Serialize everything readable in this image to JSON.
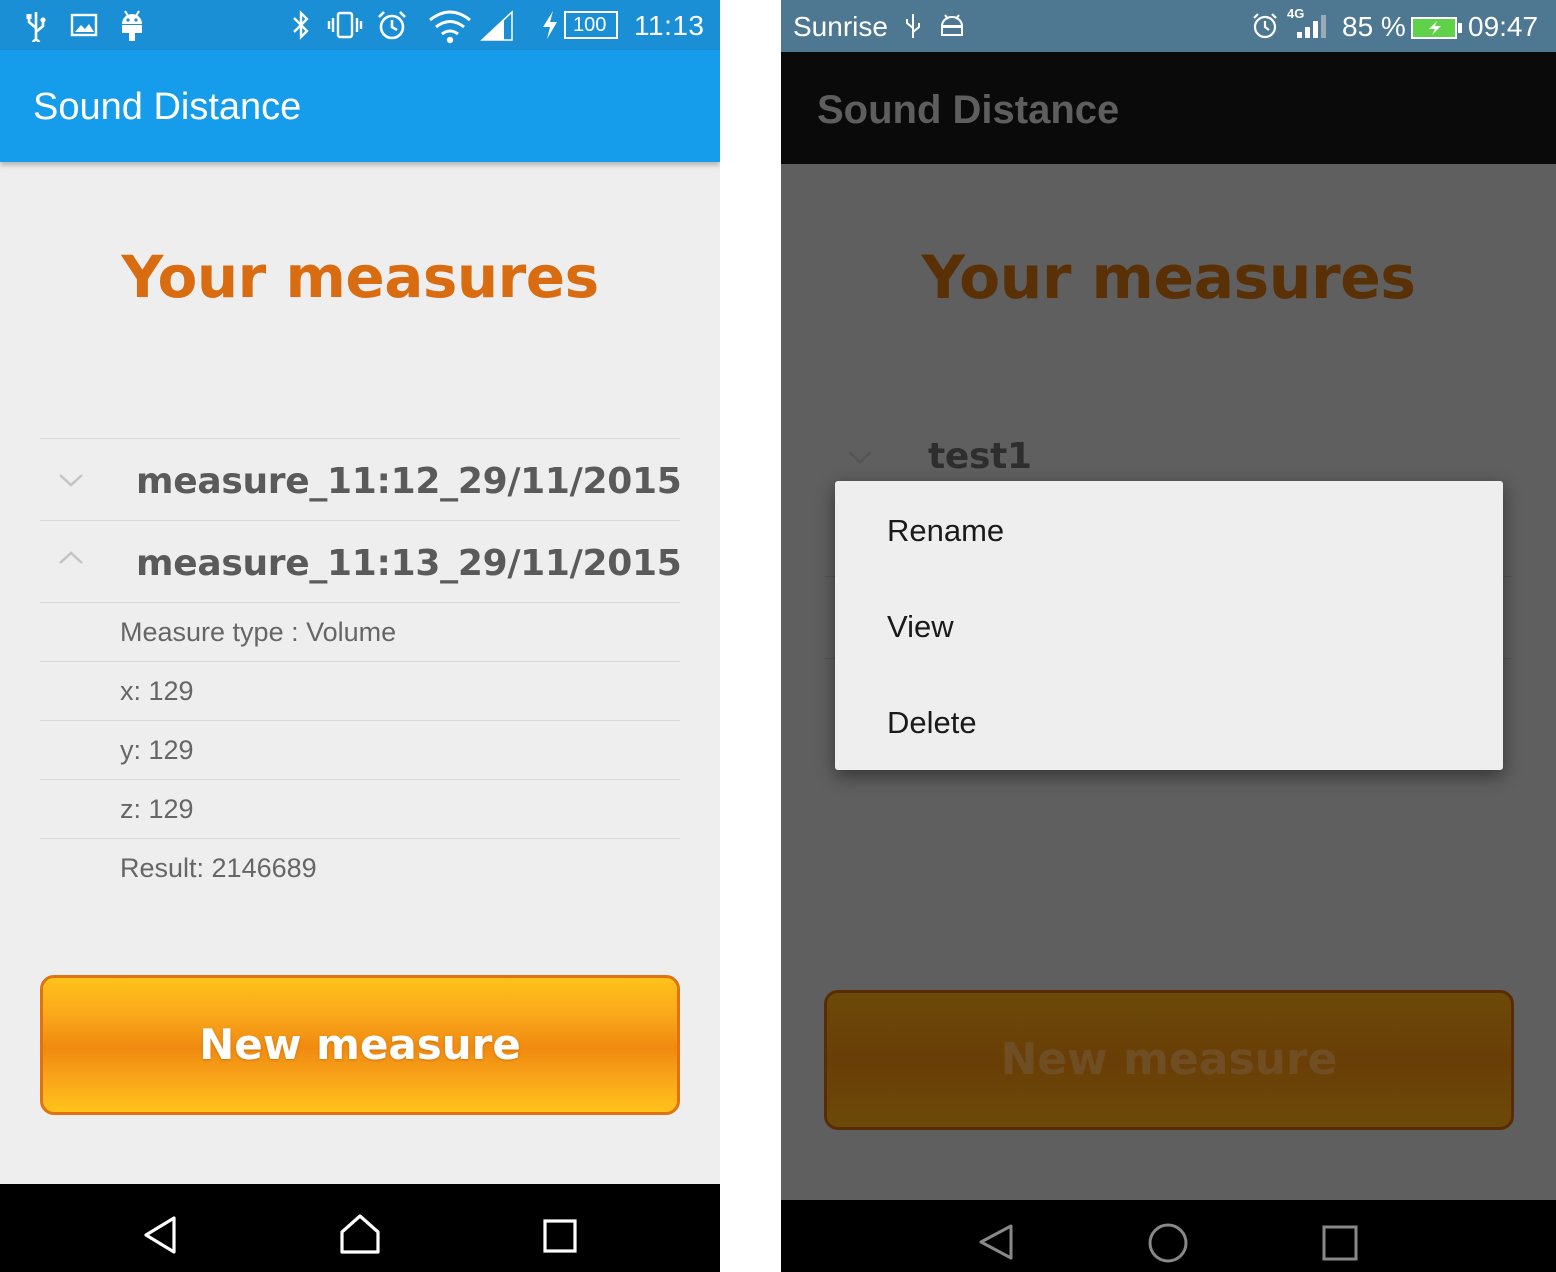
{
  "left_screen": {
    "status": {
      "battery": "100",
      "time": "11:13"
    },
    "app_title": "Sound Distance",
    "heading": "Your measures",
    "groups": [
      {
        "label": "measure_11:12_29/11/2015",
        "expanded": false
      },
      {
        "label": "measure_11:13_29/11/2015",
        "expanded": true
      }
    ],
    "details": [
      "Measure type : Volume",
      "x: 129",
      "y: 129",
      "z: 129",
      "Result: 2146689"
    ],
    "button_label": "New measure"
  },
  "right_screen": {
    "status": {
      "carrier": "Sunrise",
      "network": "4G",
      "battery_percent": "85 %",
      "time": "09:47"
    },
    "app_title": "Sound Distance",
    "heading": "Your measures",
    "groups": [
      {
        "label": "test1",
        "expanded": false
      }
    ],
    "context_menu": [
      "Rename",
      "View",
      "Delete"
    ],
    "button_label": "New measure"
  },
  "colors": {
    "left_status": "#1a8fd6",
    "left_toolbar": "#159ceb",
    "heading_orange": "#d96c10",
    "button_border": "#e07212",
    "right_status": "#4e7892",
    "right_toolbar": "#0a0a0a",
    "dim_overlay": "#5f5f5f"
  }
}
